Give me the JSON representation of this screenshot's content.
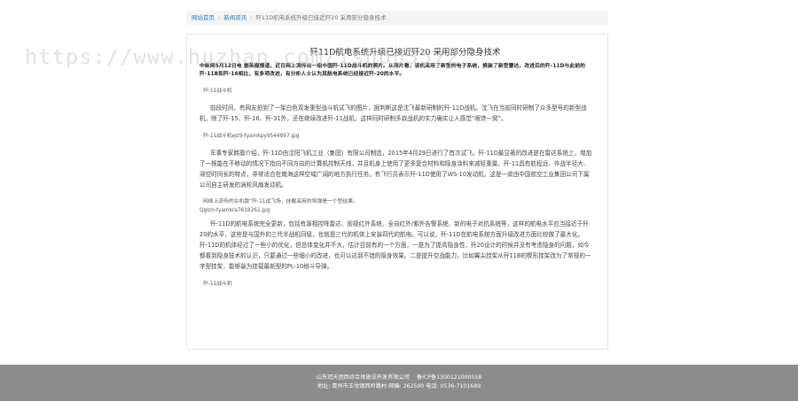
{
  "breadcrumb": {
    "home": "网站首页",
    "section": "新闻资讯",
    "current": "歼11D航电系统升级已接近歼20 采用部分隐身技术"
  },
  "article": {
    "title": "歼11D航电系统升级已接近歼20 采用部分隐身技术",
    "intro": "中新网5月12日电 据英媒报道，近日网上流传出一组中国歼-11D战斗机的照片。从照片看，该机采用了新型的电子系统，换装了新型雷达，改进后的歼-11D与此前的歼-11B和歼-16相比，有多项改进，有分析人士认为其航电系统已经接近歼-20的水平。",
    "caption1": "歼-11战斗机",
    "para1": "前段时间，有网友拍到了一架白色双发重型战斗机试飞的图片，据判断这是沈飞最新研制的歼-11D战机。沈飞在当前同时研制了众多型号的新型战机，除了歼-15、歼-16、歼-31外，还在继续改进歼-11战机，这样同时研制多款战机的实力确实让人感觉“眼馋一窝”。",
    "caption2": "歼-11战斗机ejc9-fyamkpy9544897.jpg",
    "para2": "军事专家韩裔介绍，歼-11D由沈阳飞机工业（集团）有限公司制造，2015年4月29日进行了首次试飞。歼-11D最显著的改进是在雷达系统上，增加了一根能在不移动的情况下指向不同方向的计算机控制天线，并且机身上使用了更多复合材料和隐身涂料来减轻重量。歼-11具有航程远、作战半径大、滞空时间长的特点，非常适合在南海这样空域广阔的地方执行任务。有飞行员表示歼-11D使用了WS-10发动机，这是一款由中国航空工业集团公司下属公司自主研发的涡轮风扇发动机。",
    "caption3_line1": "网络上流传的尖机版“歼-11试飞场，挂载采用的导弹是一个型结果。",
    "caption3_line2": "Qgsm-fyamkra7618261.jpg",
    "para3": "歼-11D的航电系统完全更新，包括有源相控阵雷达、前视红外系统、全向红外/紫外告警系统、新的电子对抗系统等，这样的航电水平应当接近于歼20的水平，这些是与国外的三代半战机同级，也就是三代的机体上安装四代的航电。可以说，歼-11D在航电系统方面升级改进方面比较做了最大化。歼-11D的机体经过了一些小的优化，但总体变化并不大，估计目前有的一个方面，一是为了提高隐身性，歼20设计的时候并没有考虑隐身的问题，如今都看到隐身技术的认识，只要通过一些细小的改进，也可以达到不错的隐身效果。二是提升空战能力，比如翼尖挂架从歼11B的楔形挂架改为了常规的一字型挂架，能够装为挂载最新型的PL-10格斗导弹。",
    "caption4": "歼-11战斗机"
  },
  "watermark": "https://www.huzhan.com/ishop3572",
  "footer": {
    "company": "山东冠天团西综合体施设开发有限公司",
    "icp": "备ICP备1300121000558",
    "address": "地址: 青州市王坟镇西岭路村 邮编: 262500 电话: 0536-7101689"
  }
}
